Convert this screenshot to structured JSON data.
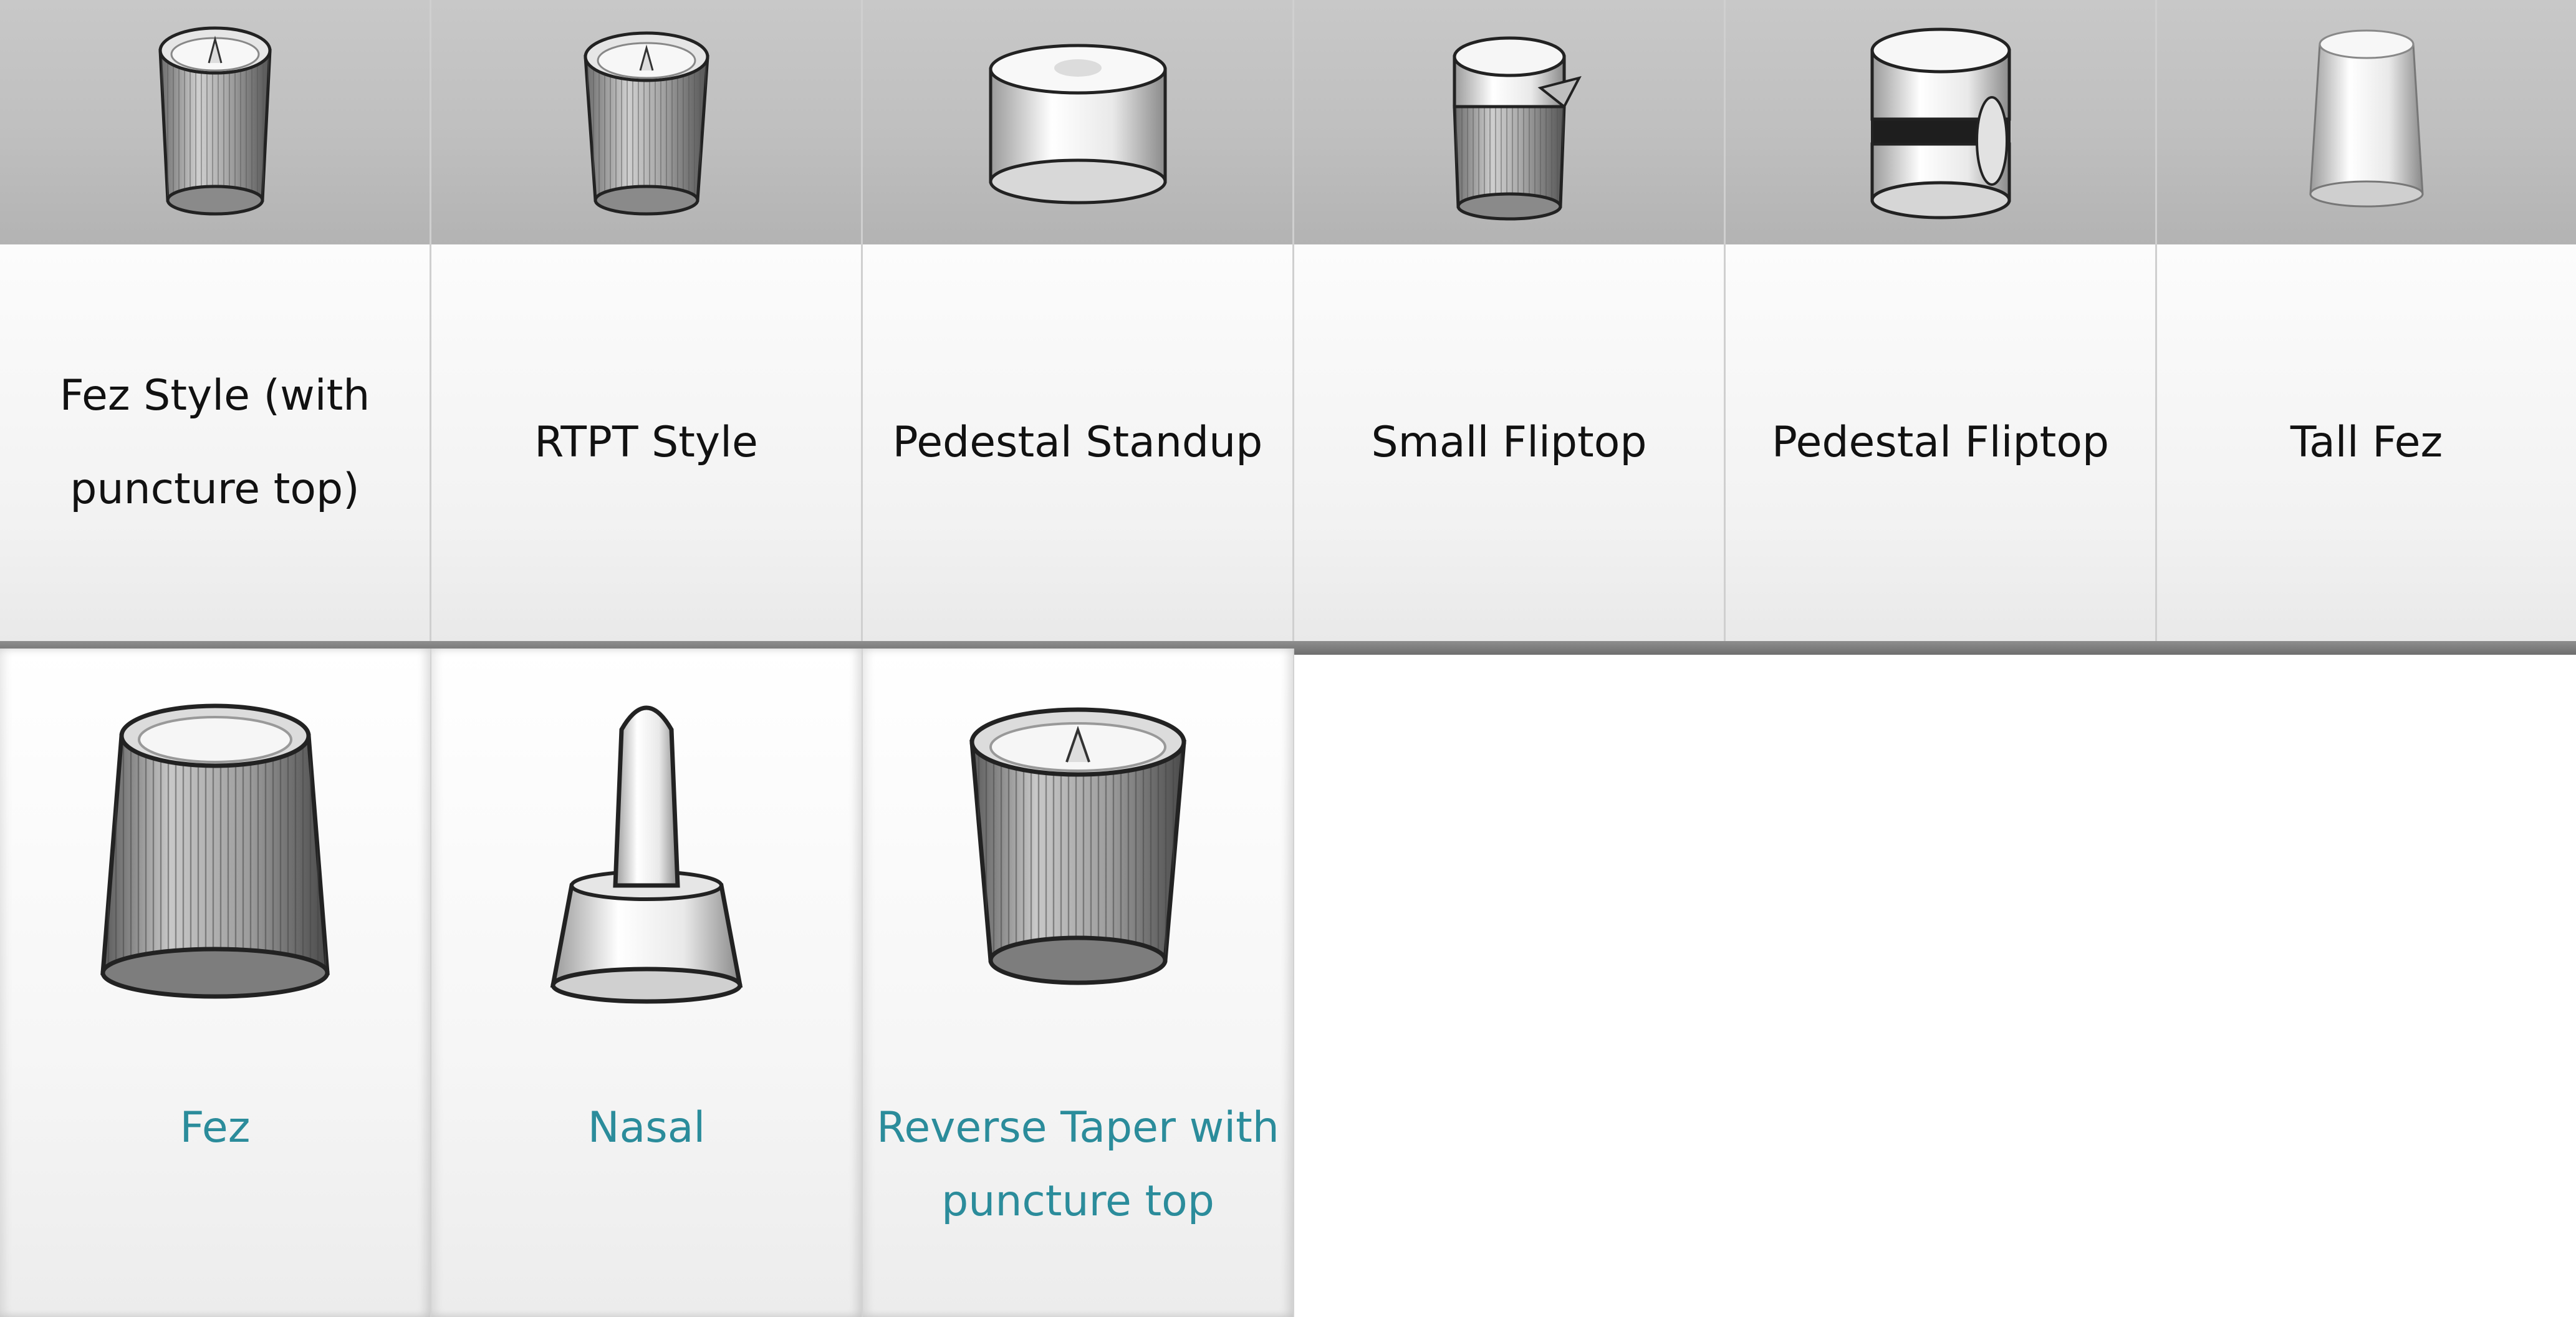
{
  "top_row": [
    {
      "label": "Fez Style (with puncture top)",
      "icon": "fez-puncture-cap-icon"
    },
    {
      "label": "RTPT Style",
      "icon": "rtpt-cap-icon"
    },
    {
      "label": "Pedestal Standup",
      "icon": "pedestal-standup-cap-icon"
    },
    {
      "label": "Small Fliptop",
      "icon": "small-fliptop-cap-icon"
    },
    {
      "label": "Pedestal Fliptop",
      "icon": "pedestal-fliptop-cap-icon"
    },
    {
      "label": "Tall Fez",
      "icon": "tall-fez-cap-icon"
    }
  ],
  "bottom_row": [
    {
      "label": "Fez",
      "icon": "fez-cap-icon"
    },
    {
      "label": "Nasal",
      "icon": "nasal-cap-icon"
    },
    {
      "label": "Reverse Taper with puncture top",
      "icon": "reverse-taper-cap-icon"
    }
  ],
  "colors": {
    "link_text": "#2b8c9b",
    "header_gray": "#c2c2c2",
    "divider": "#7a7a7a"
  }
}
